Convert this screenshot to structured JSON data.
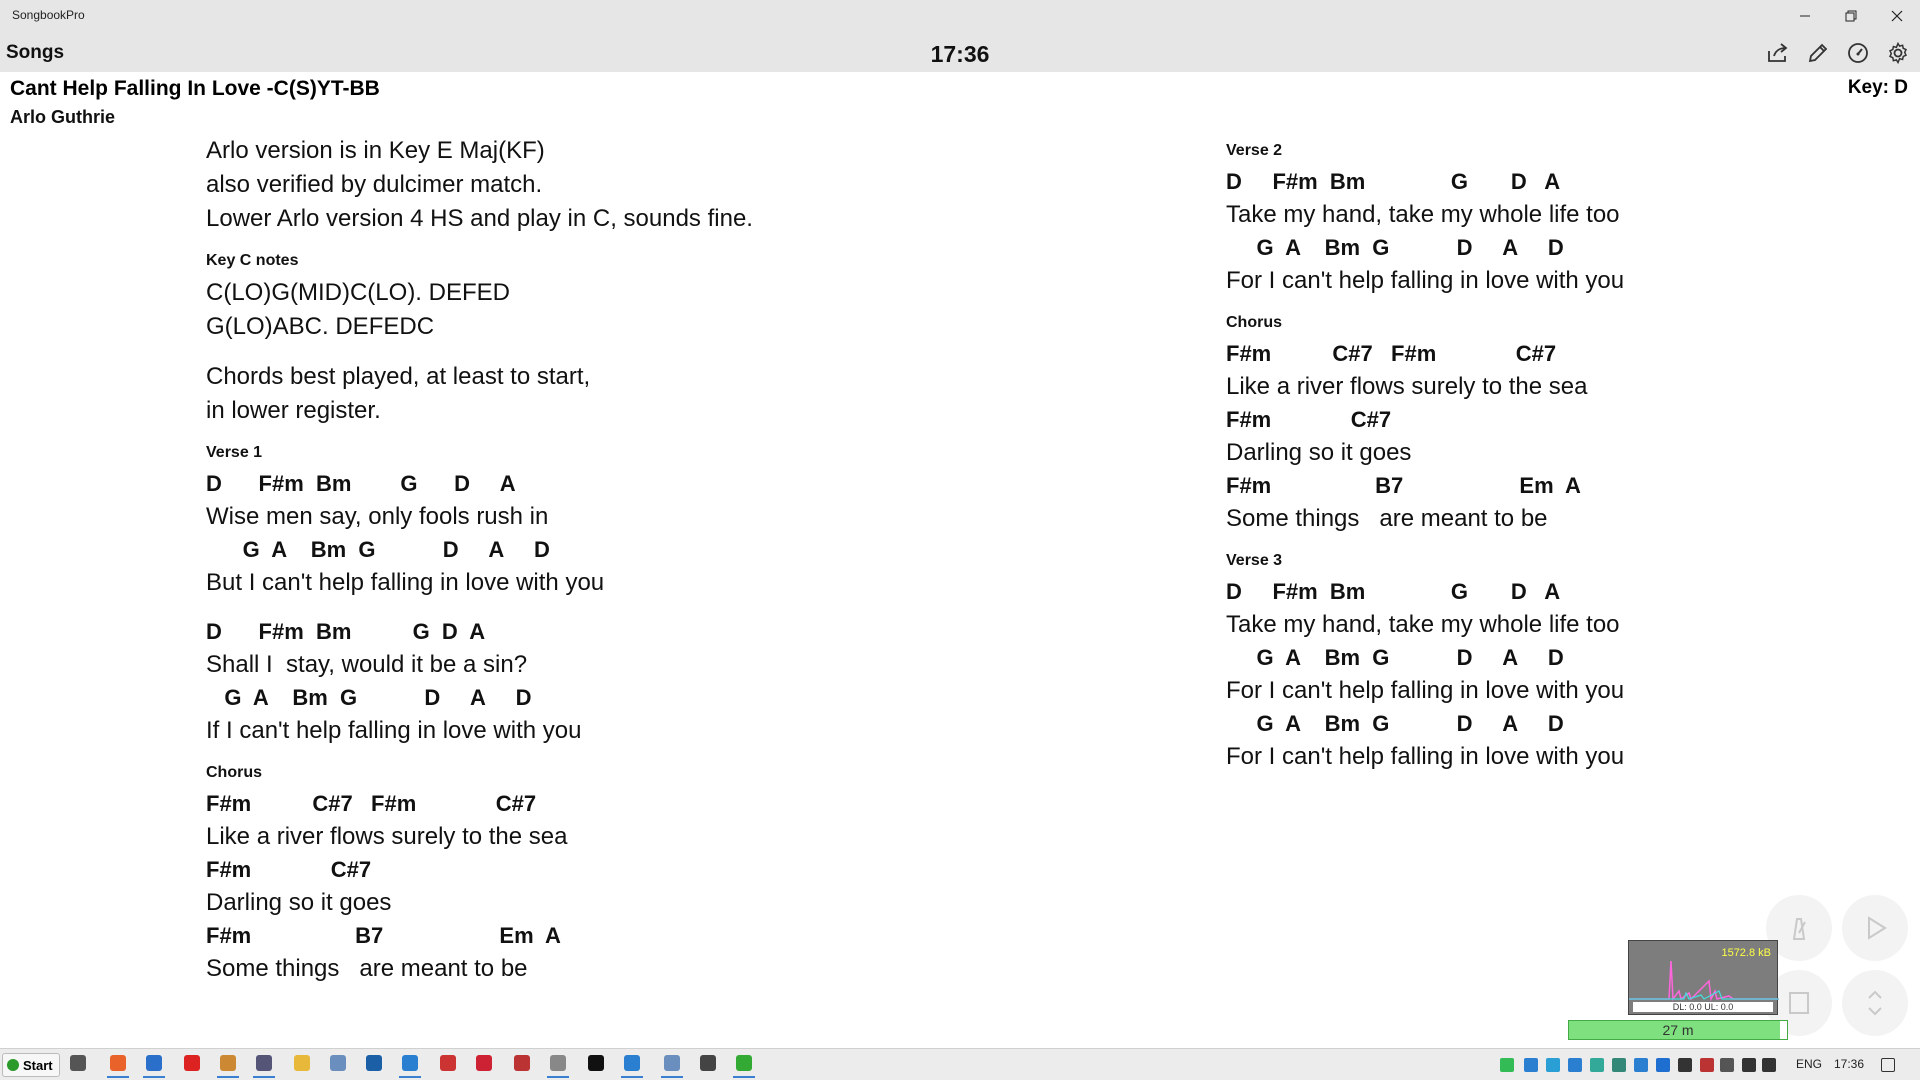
{
  "window": {
    "app_title": "SongbookPro"
  },
  "command_bar": {
    "songs_label": "Songs",
    "clock": "17:36"
  },
  "song": {
    "title": "Cant Help Falling In Love -C(S)YT-BB",
    "artist": "Arlo Guthrie",
    "key_label": "Key: D"
  },
  "left_column": {
    "intro": [
      "Arlo version is in Key E Maj(KF)",
      "also verified by dulcimer match.",
      "Lower Arlo version 4 HS and play in C, sounds fine."
    ],
    "keyc": {
      "label": "Key C notes",
      "lines": [
        "C(LO)G(MID)C(LO). DEFED",
        "G(LO)ABC. DEFEDC"
      ]
    },
    "chords_note": [
      "Chords best played, at least to start,",
      "in lower register."
    ],
    "verse1": {
      "label": "Verse 1",
      "block1": [
        "D      F#m  Bm        G      D     A",
        "Wise men say, only fools rush in",
        "      G  A    Bm  G           D     A     D",
        "But I can't help falling in love with you"
      ],
      "block2": [
        "D      F#m  Bm          G  D  A",
        "Shall I  stay, would it be a sin?",
        "   G  A    Bm  G           D     A     D",
        "If I can't help falling in love with you"
      ]
    },
    "chorus": {
      "label": "Chorus",
      "lines": [
        "F#m          C#7   F#m             C#7",
        "Like a river flows surely to the sea",
        "F#m             C#7",
        "Darling so it goes",
        "F#m                 B7                   Em  A",
        "Some things   are meant to be"
      ]
    }
  },
  "right_column": {
    "verse2": {
      "label": "Verse 2",
      "lines": [
        "D     F#m  Bm              G       D   A",
        "Take my hand, take my whole life too",
        "     G  A    Bm  G           D     A     D",
        "For I can't help falling in love with you"
      ]
    },
    "chorus": {
      "label": "Chorus",
      "lines": [
        "F#m          C#7   F#m             C#7",
        "Like a river flows surely to the sea",
        "F#m             C#7",
        "Darling so it goes",
        "F#m                 B7                   Em  A",
        "Some things   are meant to be"
      ]
    },
    "verse3": {
      "label": "Verse 3",
      "lines": [
        "D     F#m  Bm              G       D   A",
        "Take my hand, take my whole life too",
        "     G  A    Bm  G           D     A     D",
        "For I can't help falling in love with you",
        "     G  A    Bm  G           D     A     D",
        "For I can't help falling in love with you"
      ]
    }
  },
  "overlay": {
    "net_rate": "1572.8 kB",
    "dl_ul": "DL: 0.0  UL: 0.0",
    "timer": "27 m",
    "timer_progress": 0.97
  },
  "taskbar": {
    "start_label": "Start",
    "lang": "ENG",
    "time": "17:36"
  },
  "icons": {
    "window_controls": [
      "minimize-icon",
      "restore-icon",
      "close-icon"
    ],
    "toolbar": [
      "share-icon",
      "pencil-icon",
      "speedometer-icon",
      "gear-icon"
    ],
    "floating": [
      "metronome-icon",
      "play-icon",
      "page-icon",
      "autoscroll-icon"
    ]
  }
}
